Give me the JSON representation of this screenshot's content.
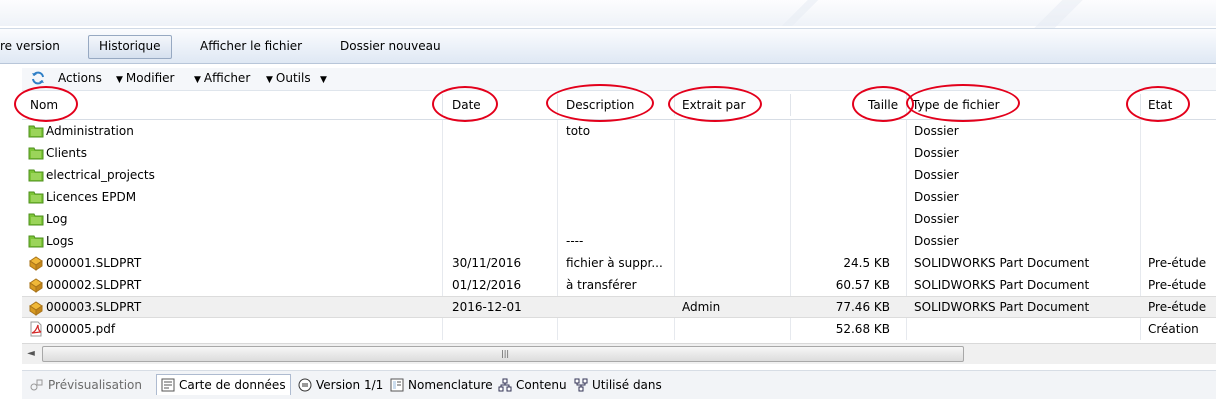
{
  "toolbar": {
    "items": [
      "re version",
      "Historique",
      "Afficher le fichier",
      "Dossier nouveau"
    ],
    "active": "Historique"
  },
  "commandbar": {
    "refresh_icon": "refresh-icon",
    "items": [
      "Actions",
      "Modifier",
      "Afficher",
      "Outils"
    ]
  },
  "columns": {
    "name": "Nom",
    "date": "Date",
    "description": "Description",
    "checked_out_by": "Extrait par",
    "size": "Taille",
    "file_type": "Type de fichier",
    "state": "Etat"
  },
  "rows": [
    {
      "icon": "folder-icon",
      "name": "Administration",
      "date": "",
      "description": "toto",
      "checked_out_by": "",
      "size": "",
      "file_type": "Dossier",
      "state": ""
    },
    {
      "icon": "folder-icon",
      "name": "Clients",
      "date": "",
      "description": "",
      "checked_out_by": "",
      "size": "",
      "file_type": "Dossier",
      "state": ""
    },
    {
      "icon": "folder-icon",
      "name": "electrical_projects",
      "date": "",
      "description": "",
      "checked_out_by": "",
      "size": "",
      "file_type": "Dossier",
      "state": ""
    },
    {
      "icon": "folder-icon",
      "name": "Licences EPDM",
      "date": "",
      "description": "",
      "checked_out_by": "",
      "size": "",
      "file_type": "Dossier",
      "state": ""
    },
    {
      "icon": "folder-icon",
      "name": "Log",
      "date": "",
      "description": "",
      "checked_out_by": "",
      "size": "",
      "file_type": "Dossier",
      "state": ""
    },
    {
      "icon": "folder-icon",
      "name": "Logs",
      "date": "",
      "description": "----",
      "checked_out_by": "",
      "size": "",
      "file_type": "Dossier",
      "state": ""
    },
    {
      "icon": "solidworks-part-icon",
      "name": "000001.SLDPRT",
      "date": "30/11/2016",
      "description": "fichier à suppr...",
      "checked_out_by": "",
      "size": "24.5 KB",
      "file_type": "SOLIDWORKS Part Document",
      "state": "Pre-étude"
    },
    {
      "icon": "solidworks-part-icon",
      "name": "000002.SLDPRT",
      "date": "01/12/2016",
      "description": "à transférer",
      "checked_out_by": "",
      "size": "60.57 KB",
      "file_type": "SOLIDWORKS Part Document",
      "state": "Pre-étude"
    },
    {
      "icon": "solidworks-part-icon",
      "name": "000003.SLDPRT",
      "date": "2016-12-01",
      "description": "",
      "checked_out_by": "Admin",
      "size": "77.46 KB",
      "file_type": "SOLIDWORKS Part Document",
      "state": "Pre-étude"
    },
    {
      "icon": "pdf-icon",
      "name": "000005.pdf",
      "date": "",
      "description": "",
      "checked_out_by": "",
      "size": "52.68 KB",
      "file_type": "",
      "state": "Création"
    }
  ],
  "selected_row": 8,
  "bottom_tabs": {
    "preview": "Prévisualisation",
    "datacard": "Carte de données",
    "version": "Version 1/1",
    "bom": "Nomenclature",
    "contains": "Contenu",
    "where_used": "Utilisé dans"
  },
  "active_bottom_tab": "Carte de données",
  "colors": {
    "annotation_circle": "#e3001b",
    "folder_green": "#6fbf2a",
    "part_orange": "#e0a020",
    "pdf_red": "#d42b2b"
  }
}
